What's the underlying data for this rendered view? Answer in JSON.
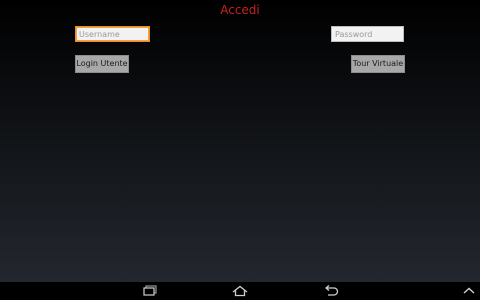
{
  "login_screen": {
    "title": "Accedi",
    "username_placeholder": "Username",
    "password_placeholder": "Password",
    "login_button_label": "Login Utente",
    "tour_button_label": "Tour Virtuale"
  },
  "colors": {
    "title": "#c62222",
    "focus_border": "#f08a24",
    "button_bg": "#a8a8a8"
  },
  "navbar": {
    "icons": [
      "recent-apps-icon",
      "home-icon",
      "back-icon",
      "chevron-up-icon"
    ]
  }
}
